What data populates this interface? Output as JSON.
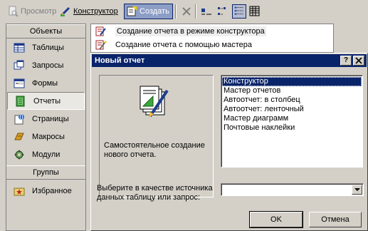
{
  "toolbar": {
    "preview_label": "Просмотр",
    "design_label": "Конструктор",
    "create_label": "Создать"
  },
  "objects_panel": {
    "objects_header": "Объекты",
    "items": [
      {
        "label": "Таблицы",
        "icon": "table-icon"
      },
      {
        "label": "Запросы",
        "icon": "query-icon"
      },
      {
        "label": "Формы",
        "icon": "form-icon"
      },
      {
        "label": "Отчеты",
        "icon": "report-icon",
        "selected": true
      },
      {
        "label": "Страницы",
        "icon": "page-icon"
      },
      {
        "label": "Макросы",
        "icon": "macro-icon"
      },
      {
        "label": "Модули",
        "icon": "module-icon"
      }
    ],
    "groups_header": "Группы",
    "favorites_label": "Избранное"
  },
  "object_list": {
    "items": [
      "Создание отчета в режиме конструктора",
      "Создание отчета с помощью мастера"
    ]
  },
  "dialog": {
    "title": "Новый отчет",
    "help_button": "?",
    "close_button": "X",
    "description": "Самостоятельное создание нового отчета.",
    "types": [
      "Конструктор",
      "Мастер отчетов",
      "Автоотчет: в столбец",
      "Автоотчет: ленточный",
      "Мастер диаграмм",
      "Почтовые наклейки"
    ],
    "selected_type": "Конструктор",
    "source_label": "Выберите в качестве источника данных таблицу или запрос:",
    "source_value": "",
    "ok_label": "OK",
    "cancel_label": "Отмена"
  },
  "colors": {
    "title_bar": "#0a246a",
    "face": "#d4d0c8",
    "selection": "#0a246a"
  }
}
